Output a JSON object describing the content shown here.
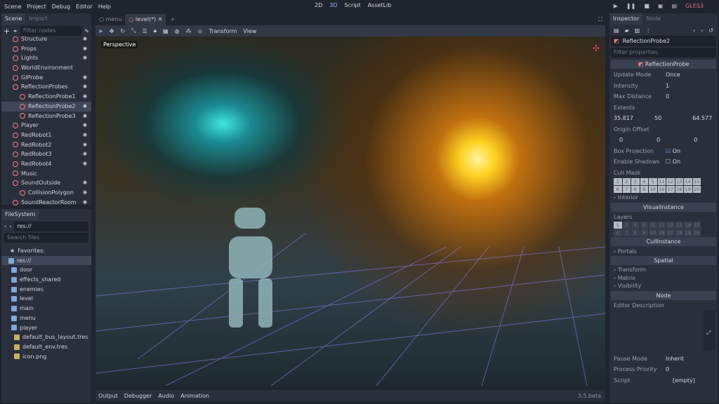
{
  "menu": [
    "Scene",
    "Project",
    "Debug",
    "Editor",
    "Help"
  ],
  "modes": {
    "m2d": "2D",
    "m3d": "3D",
    "script": "Script",
    "assetlib": "AssetLib"
  },
  "renderer": "GLES3",
  "scene_dock": {
    "tabs": [
      "Scene",
      "Import"
    ],
    "filter_placeholder": "Filter nodes",
    "nodes": [
      {
        "label": "Structure",
        "indent": 1,
        "icon": "spatial-icon"
      },
      {
        "label": "Props",
        "indent": 1,
        "icon": "spatial-icon"
      },
      {
        "label": "Lights",
        "indent": 1,
        "icon": "spatial-icon"
      },
      {
        "label": "WorldEnvironment",
        "indent": 1,
        "icon": "world-environment-icon"
      },
      {
        "label": "GIProbe",
        "indent": 1,
        "icon": "giprobe-icon"
      },
      {
        "label": "ReflectionProbes",
        "indent": 1,
        "icon": "spatial-icon"
      },
      {
        "label": "ReflectionProbe1",
        "indent": 2,
        "icon": "reflection-probe-icon"
      },
      {
        "label": "ReflectionProbe2",
        "indent": 2,
        "icon": "reflection-probe-icon",
        "selected": true
      },
      {
        "label": "ReflectionProbe3",
        "indent": 2,
        "icon": "reflection-probe-icon"
      },
      {
        "label": "Player",
        "indent": 1,
        "icon": "instance-icon"
      },
      {
        "label": "RedRobot1",
        "indent": 1,
        "icon": "instance-icon"
      },
      {
        "label": "RedRobot2",
        "indent": 1,
        "icon": "instance-icon"
      },
      {
        "label": "RedRobot3",
        "indent": 1,
        "icon": "instance-icon"
      },
      {
        "label": "RedRobot4",
        "indent": 1,
        "icon": "instance-icon"
      },
      {
        "label": "Music",
        "indent": 1,
        "icon": "audio-icon"
      },
      {
        "label": "SoundOutside",
        "indent": 1,
        "icon": "area-icon"
      },
      {
        "label": "CollisionPolygon",
        "indent": 2,
        "icon": "collision-polygon-icon"
      },
      {
        "label": "SoundReactorRoom",
        "indent": 1,
        "icon": "area-icon"
      }
    ]
  },
  "filesystem": {
    "title": "FileSystem",
    "path": "res://",
    "search_placeholder": "Search files",
    "favorites": "Favorites:",
    "root": "res://",
    "items": [
      {
        "label": "door",
        "type": "folder"
      },
      {
        "label": "effects_shared",
        "type": "folder"
      },
      {
        "label": "enemies",
        "type": "folder"
      },
      {
        "label": "level",
        "type": "folder"
      },
      {
        "label": "main",
        "type": "folder"
      },
      {
        "label": "menu",
        "type": "folder"
      },
      {
        "label": "player",
        "type": "folder"
      },
      {
        "label": "default_bus_layout.tres",
        "type": "file"
      },
      {
        "label": "default_env.tres",
        "type": "file"
      },
      {
        "label": "icon.png",
        "type": "file"
      }
    ]
  },
  "editor_tabs": [
    "menu",
    "level(*)"
  ],
  "toolbar": {
    "transform": "Transform",
    "view": "View"
  },
  "viewport": {
    "perspective": "Perspective"
  },
  "bottom": {
    "tabs": [
      "Output",
      "Debugger",
      "Audio",
      "Animation"
    ],
    "version": "3.5.beta"
  },
  "inspector": {
    "tabs": [
      "Inspector",
      "Node"
    ],
    "node_name": "ReflectionProbe2",
    "filter_placeholder": "Filter properties",
    "class_header": "ReflectionProbe",
    "update_mode": {
      "label": "Update Mode",
      "value": "Once"
    },
    "intensity": {
      "label": "Intensity",
      "value": "1"
    },
    "max_distance": {
      "label": "Max Distance",
      "value": "0"
    },
    "extents": {
      "label": "Extents",
      "x": "35.817",
      "y": "50",
      "z": "64.577"
    },
    "origin_offset": {
      "label": "Origin Offset",
      "x": "0",
      "y": "0",
      "z": "0"
    },
    "box_projection": {
      "label": "Box Projection",
      "value": "On",
      "checked": true
    },
    "enable_shadows": {
      "label": "Enable Shadows",
      "value": "On",
      "checked": false
    },
    "cull_mask": {
      "label": "Cull Mask"
    },
    "interior": "Interior",
    "visual_instance": "VisualInstance",
    "layers": {
      "label": "Layers",
      "active": [
        1
      ]
    },
    "cull_instance": "CullInstance",
    "portals": "Portals",
    "spatial": "Spatial",
    "transform": "Transform",
    "matrix": "Matrix",
    "visibility": "Visibility",
    "node": "Node",
    "editor_description": "Editor Description",
    "pause_mode": {
      "label": "Pause Mode",
      "value": "Inherit"
    },
    "process_priority": {
      "label": "Process Priority",
      "value": "0"
    },
    "script": {
      "label": "Script",
      "value": "[empty]"
    }
  }
}
